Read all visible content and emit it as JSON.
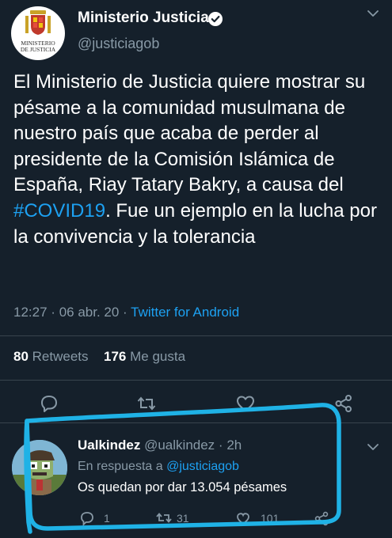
{
  "tweet": {
    "author_name": "Ministerio Justicia",
    "author_handle": "@justiciagob",
    "logo_text_1": "MINISTERIO",
    "logo_text_2": "DE JUSTICIA",
    "text_before": "El Ministerio de Justicia quiere mostrar su pésame a la comunidad musulmana de nuestro país que acaba de perder al presidente de la Comisión Islámica de España, Riay Tatary Bakry, a causa del ",
    "hashtag": "#COVID19",
    "text_after": ". Fue un ejemplo en la lucha por la convivencia y la tolerancia",
    "time": "12:27",
    "date": "06 abr. 20",
    "separator": "·",
    "source": "Twitter for Android",
    "retweets_count": "80",
    "retweets_label": "Retweets",
    "likes_count": "176",
    "likes_label": "Me gusta"
  },
  "actions": [
    "reply-icon",
    "retweet-icon",
    "like-icon",
    "share-icon"
  ],
  "reply": {
    "author_name": "Ualkindez",
    "author_handle": "@ualkindez",
    "separator": "·",
    "time": "2h",
    "in_reply_prefix": "En respuesta a",
    "in_reply_handle": "@justiciagob",
    "text": "Os quedan por dar 13.054 pésames",
    "reply_count": "1",
    "retweet_count": "31",
    "like_count": "101"
  },
  "colors": {
    "background": "#15202b",
    "accent": "#1da1f2",
    "muted": "#8899a6",
    "divider": "#38444d",
    "annotation": "#1fb2e6"
  }
}
